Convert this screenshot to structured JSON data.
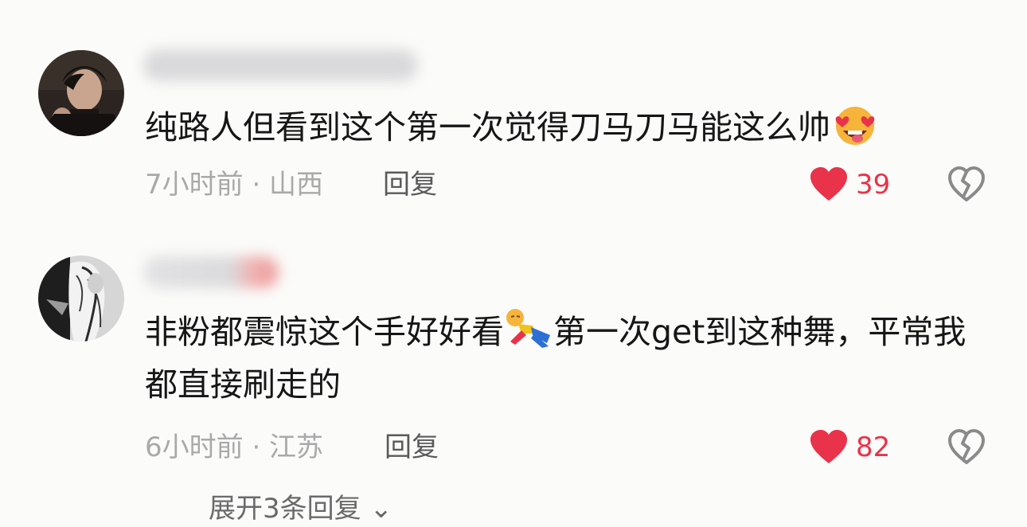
{
  "comments": [
    {
      "text": "纯路人但看到这个第一次觉得刀马刀马能这么帅",
      "emoji": "heart-eyes-emoji",
      "time_location": "7小时前 · 山西",
      "reply_label": "回复",
      "likes": "39"
    },
    {
      "text_before": "非粉都震惊这个手好好看",
      "emoji": "falling-person-emoji",
      "text_after": "第一次get到这种舞，平常我都直接刷走的",
      "time_location": "6小时前 · 江苏",
      "reply_label": "回复",
      "likes": "82"
    }
  ],
  "expand_replies": "展开3条回复",
  "colors": {
    "like_red": "#e8334a",
    "meta_gray": "#a9a9a9",
    "text": "#161616",
    "background": "#fbfbf9"
  }
}
